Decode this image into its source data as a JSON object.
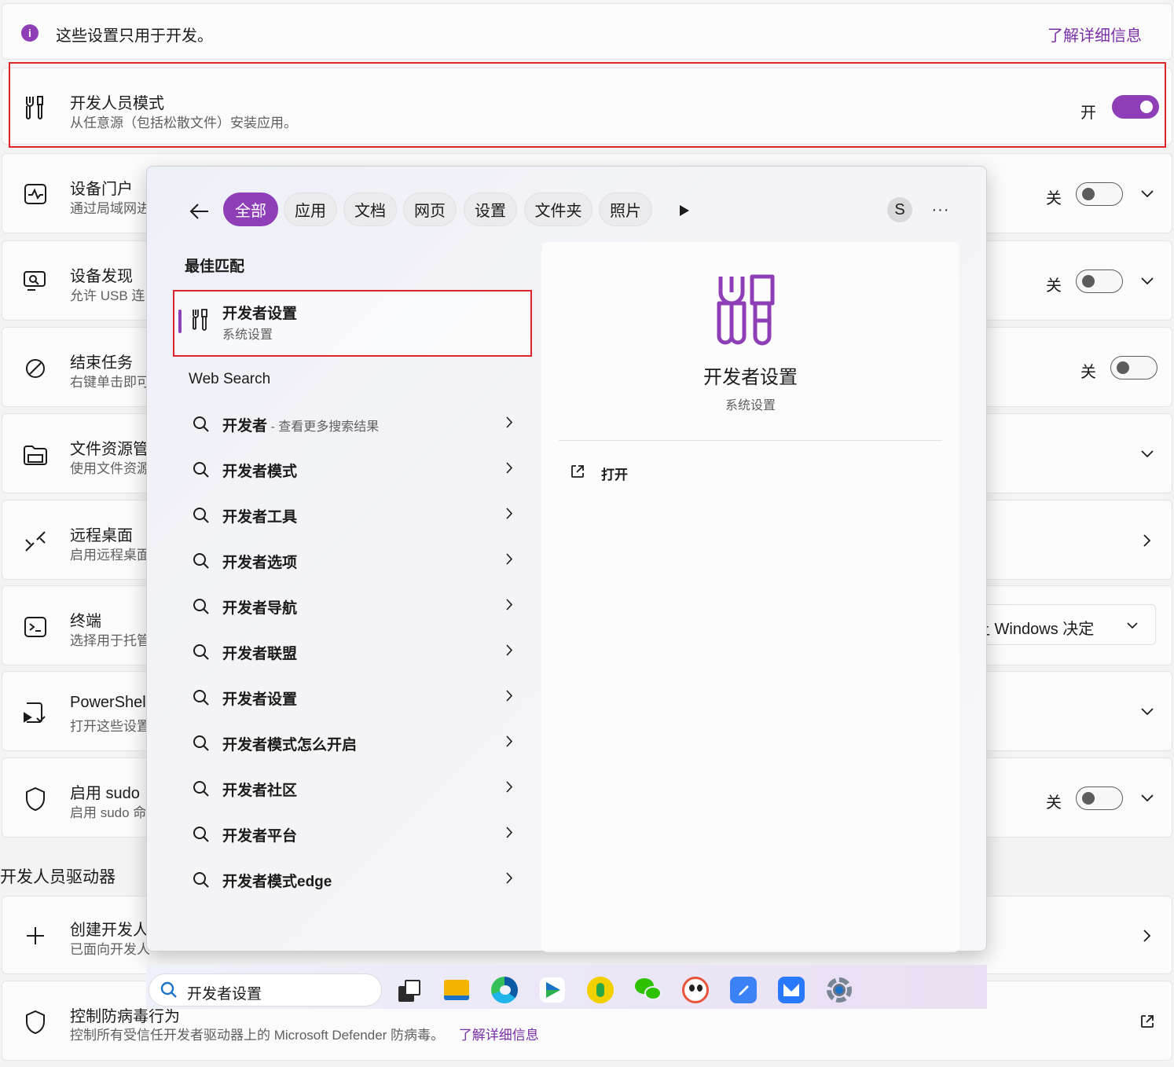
{
  "info_bar": {
    "text": "这些设置只用于开发。",
    "link": "了解详细信息"
  },
  "settings": {
    "developer_mode": {
      "title": "开发人员模式",
      "subtitle": "从任意源（包括松散文件）安装应用。",
      "state": "开"
    },
    "device_portal": {
      "title": "设备门户",
      "subtitle": "通过局域网进",
      "state": "关"
    },
    "device_discovery": {
      "title": "设备发现",
      "subtitle": "允许 USB 连",
      "state": "关"
    },
    "end_task": {
      "title": "结束任务",
      "subtitle": "右键单击即可",
      "state": "关"
    },
    "file_explorer": {
      "title": "文件资源管",
      "subtitle": "使用文件资源"
    },
    "remote_desktop": {
      "title": "远程桌面",
      "subtitle": "启用远程桌面"
    },
    "terminal": {
      "title": "终端",
      "subtitle": "选择用于托管",
      "dropdown": "让 Windows 决定"
    },
    "powershell": {
      "title": "PowerShel",
      "subtitle": "打开这些设置"
    },
    "sudo": {
      "title": "启用 sudo",
      "subtitle": "启用 sudo 命",
      "state": "关"
    },
    "section_drivers": "开发人员驱动器",
    "create_drive": {
      "title": "创建开发人",
      "subtitle": "已面向开发人"
    },
    "antivirus": {
      "title": "控制防病毒行为",
      "subtitle": "控制所有受信任开发者驱动器上的 Microsoft Defender 防病毒。",
      "link": "了解详细信息"
    }
  },
  "search": {
    "filters": [
      "全部",
      "应用",
      "文档",
      "网页",
      "设置",
      "文件夹",
      "照片"
    ],
    "avatar": "S",
    "best_match_heading": "最佳匹配",
    "best_match": {
      "title": "开发者设置",
      "subtitle": "系统设置"
    },
    "web_search_heading": "Web Search",
    "results": [
      {
        "text": "开发者",
        "extra": " - 查看更多搜索结果"
      },
      {
        "text": "开发者模式",
        "extra": ""
      },
      {
        "text": "开发者工具",
        "extra": ""
      },
      {
        "text": "开发者选项",
        "extra": ""
      },
      {
        "text": "开发者导航",
        "extra": ""
      },
      {
        "text": "开发者联盟",
        "extra": ""
      },
      {
        "text": "开发者设置",
        "extra": ""
      },
      {
        "text": "开发者模式怎么开启",
        "extra": ""
      },
      {
        "text": "开发者社区",
        "extra": ""
      },
      {
        "text": "开发者平台",
        "extra": ""
      },
      {
        "text": "开发者模式edge",
        "extra": ""
      }
    ],
    "detail": {
      "title": "开发者设置",
      "subtitle": "系统设置",
      "open_action": "打开"
    }
  },
  "taskbar": {
    "search_value": "开发者设置",
    "icons": [
      "task-view-icon",
      "file-explorer-icon",
      "edge-icon",
      "media-player-icon",
      "music-icon",
      "wechat-icon",
      "panda-app-icon",
      "notes-app-icon",
      "mail-app-icon",
      "settings-icon"
    ]
  },
  "colors": {
    "accent": "#8e3fb8",
    "highlight_border": "#e0242b"
  }
}
